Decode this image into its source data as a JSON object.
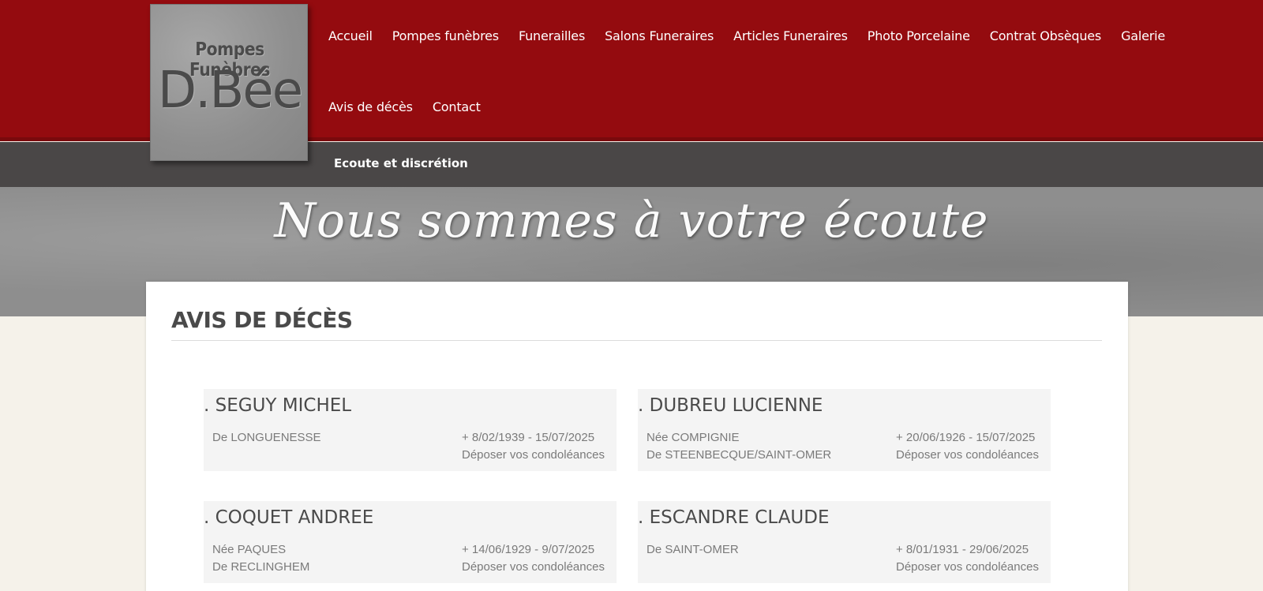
{
  "logo": {
    "line1": "Pompes Funèbres",
    "line2": "D.Bée"
  },
  "nav": {
    "row1": [
      "Accueil",
      "Pompes funèbres",
      "Funerailles",
      "Salons Funeraires",
      "Articles Funeraires",
      "Photo Porcelaine",
      "Contrat Obsèques",
      "Galerie"
    ],
    "row2": [
      "Avis de décès",
      "Contact"
    ]
  },
  "subbar": {
    "text": "Ecoute et discrétion"
  },
  "banner": {
    "text": "Nous sommes à votre écoute"
  },
  "page": {
    "title": "AVIS DE DÉCÈS"
  },
  "colors": {
    "header_red": "#940b0f",
    "subbar_gray": "#4a4747",
    "page_bg": "#f5f2ea",
    "card_bg": "#f4f4f4"
  },
  "notices": [
    {
      "name": ". SEGUY MICHEL",
      "details": [
        "De LONGUENESSE"
      ],
      "dates": "+ 8/02/1939 - 15/07/2025",
      "condolences": "Déposer vos condoléances"
    },
    {
      "name": ". DUBREU LUCIENNE",
      "details": [
        "Née COMPIGNIE",
        "De STEENBECQUE/SAINT-OMER"
      ],
      "dates": "+ 20/06/1926 - 15/07/2025",
      "condolences": "Déposer vos condoléances"
    },
    {
      "name": ". COQUET ANDREE",
      "details": [
        "Née PAQUES",
        "De RECLINGHEM"
      ],
      "dates": "+ 14/06/1929 - 9/07/2025",
      "condolences": "Déposer vos condoléances"
    },
    {
      "name": ". ESCANDRE CLAUDE",
      "details": [
        "De SAINT-OMER"
      ],
      "dates": "+ 8/01/1931 - 29/06/2025",
      "condolences": "Déposer vos condoléances"
    }
  ]
}
